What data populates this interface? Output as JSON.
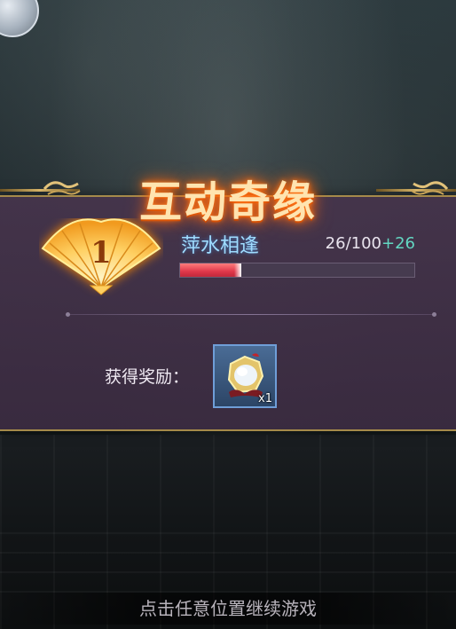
{
  "title": "互动奇缘",
  "quest": {
    "rank": "1",
    "name": "萍水相逢",
    "progress_current": "26",
    "progress_separator": "/",
    "progress_total": "100",
    "progress_gain": "+26",
    "progress_fraction": 0.26
  },
  "reward": {
    "label": "获得奖励：",
    "item_icon": "mirror-ornament-icon",
    "quantity": "x1"
  },
  "continue_hint": "点击任意位置继续游戏",
  "colors": {
    "title_glow": "#ff6a00",
    "quest_name": "#9fdcff",
    "progress_fill": "#e0374a",
    "progress_gain": "#63d7c2",
    "panel": "#46344c",
    "frame_gold": "#a58a4a"
  }
}
